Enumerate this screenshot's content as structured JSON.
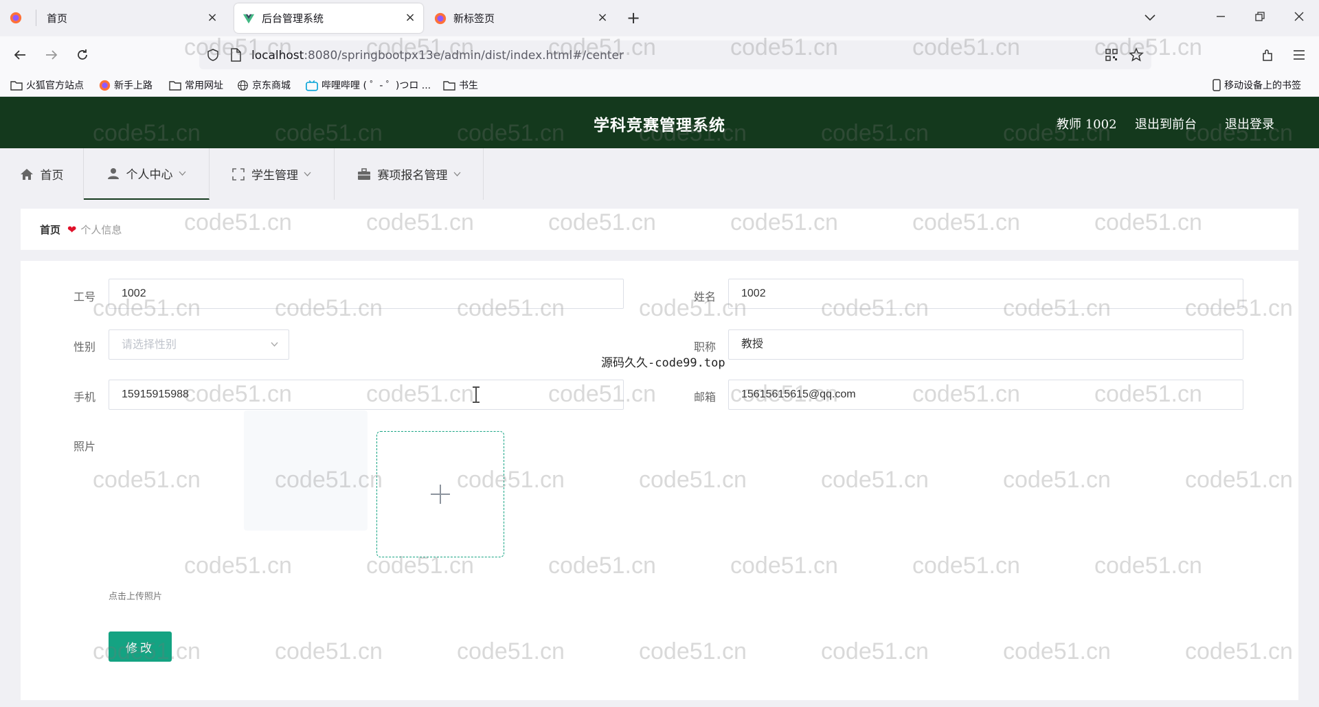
{
  "browser": {
    "tabs": [
      {
        "title": "首页"
      },
      {
        "title": "后台管理系统"
      },
      {
        "title": "新标签页"
      }
    ],
    "new_tab": "+",
    "url_host": "localhost",
    "url_path": ":8080/springbootpx13e/admin/dist/index.html#/center",
    "bookmarks": [
      {
        "label": "火狐官方站点"
      },
      {
        "label": "新手上路"
      },
      {
        "label": "常用网址"
      },
      {
        "label": "京东商城"
      },
      {
        "label": "哔哩哔哩 ( ゜- ゜)つロ ..."
      },
      {
        "label": "书生"
      }
    ],
    "mobile_bookmarks": "移动设备上的书签"
  },
  "header": {
    "title": "学科竞赛管理系统",
    "user": "教师 1002",
    "to_front": "退出到前台",
    "logout": "退出登录"
  },
  "menu": [
    {
      "label": "首页"
    },
    {
      "label": "个人中心"
    },
    {
      "label": "学生管理"
    },
    {
      "label": "赛项报名管理"
    }
  ],
  "breadcrumb": {
    "home": "首页",
    "current": "个人信息"
  },
  "form": {
    "id_label": "工号",
    "id_value": "1002",
    "name_label": "姓名",
    "name_value": "1002",
    "gender_label": "性别",
    "gender_placeholder": "请选择性别",
    "title_label": "职称",
    "title_value": "教授",
    "phone_label": "手机",
    "phone_value": "15915915988",
    "email_label": "邮箱",
    "email_value": "15615615615@qq.com",
    "photo_label": "照片",
    "upload_hint": "点击上传照片",
    "submit_label": "修改"
  },
  "overlay_text": "源码久久-code99.top",
  "watermark_text": "code51.cn",
  "colors": {
    "header_bg": "#14391d",
    "accent": "#14a382",
    "heart": "#e0112a"
  }
}
